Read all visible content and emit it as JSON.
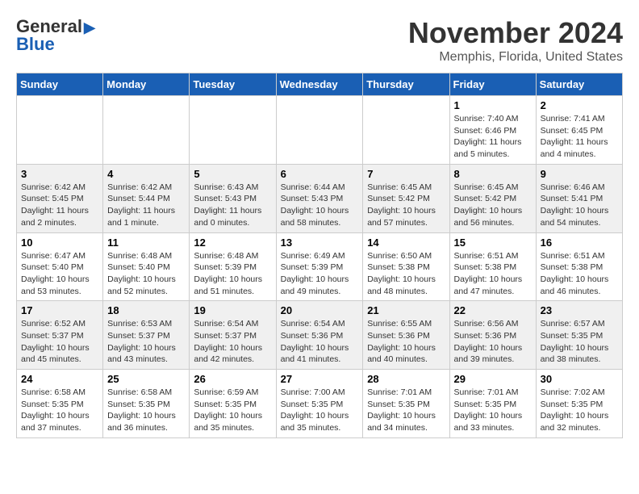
{
  "logo": {
    "line1": "General",
    "line2": "Blue",
    "arrow": "▶"
  },
  "title": "November 2024",
  "subtitle": "Memphis, Florida, United States",
  "days_of_week": [
    "Sunday",
    "Monday",
    "Tuesday",
    "Wednesday",
    "Thursday",
    "Friday",
    "Saturday"
  ],
  "weeks": [
    {
      "days": [
        {
          "num": "",
          "info": ""
        },
        {
          "num": "",
          "info": ""
        },
        {
          "num": "",
          "info": ""
        },
        {
          "num": "",
          "info": ""
        },
        {
          "num": "",
          "info": ""
        },
        {
          "num": "1",
          "info": "Sunrise: 7:40 AM\nSunset: 6:46 PM\nDaylight: 11 hours\nand 5 minutes."
        },
        {
          "num": "2",
          "info": "Sunrise: 7:41 AM\nSunset: 6:45 PM\nDaylight: 11 hours\nand 4 minutes."
        }
      ]
    },
    {
      "days": [
        {
          "num": "3",
          "info": "Sunrise: 6:42 AM\nSunset: 5:45 PM\nDaylight: 11 hours\nand 2 minutes."
        },
        {
          "num": "4",
          "info": "Sunrise: 6:42 AM\nSunset: 5:44 PM\nDaylight: 11 hours\nand 1 minute."
        },
        {
          "num": "5",
          "info": "Sunrise: 6:43 AM\nSunset: 5:43 PM\nDaylight: 11 hours\nand 0 minutes."
        },
        {
          "num": "6",
          "info": "Sunrise: 6:44 AM\nSunset: 5:43 PM\nDaylight: 10 hours\nand 58 minutes."
        },
        {
          "num": "7",
          "info": "Sunrise: 6:45 AM\nSunset: 5:42 PM\nDaylight: 10 hours\nand 57 minutes."
        },
        {
          "num": "8",
          "info": "Sunrise: 6:45 AM\nSunset: 5:42 PM\nDaylight: 10 hours\nand 56 minutes."
        },
        {
          "num": "9",
          "info": "Sunrise: 6:46 AM\nSunset: 5:41 PM\nDaylight: 10 hours\nand 54 minutes."
        }
      ]
    },
    {
      "days": [
        {
          "num": "10",
          "info": "Sunrise: 6:47 AM\nSunset: 5:40 PM\nDaylight: 10 hours\nand 53 minutes."
        },
        {
          "num": "11",
          "info": "Sunrise: 6:48 AM\nSunset: 5:40 PM\nDaylight: 10 hours\nand 52 minutes."
        },
        {
          "num": "12",
          "info": "Sunrise: 6:48 AM\nSunset: 5:39 PM\nDaylight: 10 hours\nand 51 minutes."
        },
        {
          "num": "13",
          "info": "Sunrise: 6:49 AM\nSunset: 5:39 PM\nDaylight: 10 hours\nand 49 minutes."
        },
        {
          "num": "14",
          "info": "Sunrise: 6:50 AM\nSunset: 5:38 PM\nDaylight: 10 hours\nand 48 minutes."
        },
        {
          "num": "15",
          "info": "Sunrise: 6:51 AM\nSunset: 5:38 PM\nDaylight: 10 hours\nand 47 minutes."
        },
        {
          "num": "16",
          "info": "Sunrise: 6:51 AM\nSunset: 5:38 PM\nDaylight: 10 hours\nand 46 minutes."
        }
      ]
    },
    {
      "days": [
        {
          "num": "17",
          "info": "Sunrise: 6:52 AM\nSunset: 5:37 PM\nDaylight: 10 hours\nand 45 minutes."
        },
        {
          "num": "18",
          "info": "Sunrise: 6:53 AM\nSunset: 5:37 PM\nDaylight: 10 hours\nand 43 minutes."
        },
        {
          "num": "19",
          "info": "Sunrise: 6:54 AM\nSunset: 5:37 PM\nDaylight: 10 hours\nand 42 minutes."
        },
        {
          "num": "20",
          "info": "Sunrise: 6:54 AM\nSunset: 5:36 PM\nDaylight: 10 hours\nand 41 minutes."
        },
        {
          "num": "21",
          "info": "Sunrise: 6:55 AM\nSunset: 5:36 PM\nDaylight: 10 hours\nand 40 minutes."
        },
        {
          "num": "22",
          "info": "Sunrise: 6:56 AM\nSunset: 5:36 PM\nDaylight: 10 hours\nand 39 minutes."
        },
        {
          "num": "23",
          "info": "Sunrise: 6:57 AM\nSunset: 5:35 PM\nDaylight: 10 hours\nand 38 minutes."
        }
      ]
    },
    {
      "days": [
        {
          "num": "24",
          "info": "Sunrise: 6:58 AM\nSunset: 5:35 PM\nDaylight: 10 hours\nand 37 minutes."
        },
        {
          "num": "25",
          "info": "Sunrise: 6:58 AM\nSunset: 5:35 PM\nDaylight: 10 hours\nand 36 minutes."
        },
        {
          "num": "26",
          "info": "Sunrise: 6:59 AM\nSunset: 5:35 PM\nDaylight: 10 hours\nand 35 minutes."
        },
        {
          "num": "27",
          "info": "Sunrise: 7:00 AM\nSunset: 5:35 PM\nDaylight: 10 hours\nand 35 minutes."
        },
        {
          "num": "28",
          "info": "Sunrise: 7:01 AM\nSunset: 5:35 PM\nDaylight: 10 hours\nand 34 minutes."
        },
        {
          "num": "29",
          "info": "Sunrise: 7:01 AM\nSunset: 5:35 PM\nDaylight: 10 hours\nand 33 minutes."
        },
        {
          "num": "30",
          "info": "Sunrise: 7:02 AM\nSunset: 5:35 PM\nDaylight: 10 hours\nand 32 minutes."
        }
      ]
    }
  ]
}
